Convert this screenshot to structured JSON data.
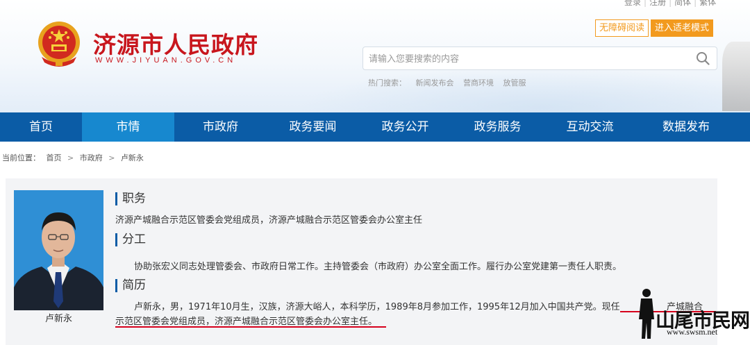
{
  "toplinks": [
    "登录",
    "注册",
    "简体",
    "繁体"
  ],
  "site": {
    "title": "济源市人民政府",
    "domain": "WWW.JIYUAN.GOV.CN",
    "accessible_label": "无障碍阅读",
    "elder_label": "进入适老模式"
  },
  "search": {
    "placeholder": "请输入您要搜索的内容",
    "hot_label": "热门搜索：",
    "hot_items": [
      "新闻发布会",
      "营商环境",
      "放管服"
    ]
  },
  "nav": [
    "首页",
    "市情",
    "市政府",
    "政务要闻",
    "政务公开",
    "政务服务",
    "互动交流",
    "数据发布"
  ],
  "nav_active": "市情",
  "breadcrumb": {
    "label": "当前位置：",
    "items": [
      "首页",
      "市政府",
      "卢新永"
    ],
    "sep": ">"
  },
  "profile": {
    "name": "卢新永",
    "duty_heading": "职务",
    "duty_text": "济源产城融合示范区管委会党组成员，济源产城融合示范区管委会办公室主任",
    "division_heading": "分工",
    "division_text": "协助张宏义同志处理管委会、市政府日常工作。主持管委会（市政府）办公室全面工作。履行办公室党建第一责任人职责。",
    "resume_heading": "简历",
    "resume_line1": "卢新永，男，1971年10月生，汉族，济源大峪人，本科学历，1989年8月参加工作，1995年12月加入中国共产党。现任",
    "resume_line1_tail": "产城融合",
    "resume_line2": "示范区管委会党组成员，济源产城融合示范区管委会办公室主任。"
  },
  "watermark": {
    "text": "山尾市民网",
    "url": "www.swsm.net"
  },
  "colors": {
    "brand_red": "#c8161d",
    "nav_blue": "#0b5ca6",
    "nav_active": "#1788cf",
    "accent_orange": "#f29a1e",
    "underline_red": "#d6001c"
  }
}
